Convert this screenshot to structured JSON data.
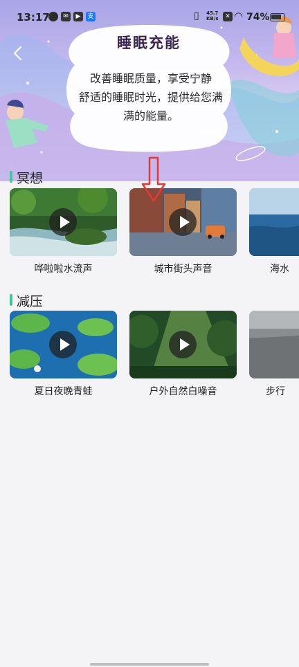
{
  "status_bar": {
    "time": "13:17",
    "net_speed_value": "45.7",
    "net_speed_unit": "KB/s",
    "battery": "74%"
  },
  "header": {
    "title": "睡眠充能",
    "description_lines": [
      "改善睡眠质量，享受宁静",
      "舒适的睡眠时光，提供给您满",
      "满的能量。"
    ]
  },
  "sections": [
    {
      "title": "冥想",
      "items": [
        {
          "label": "哗啦啦水流声"
        },
        {
          "label": "城市街头声音"
        },
        {
          "label": "海水"
        }
      ]
    },
    {
      "title": "减压",
      "items": [
        {
          "label": "夏日夜晚青蛙"
        },
        {
          "label": "户外自然白噪音"
        },
        {
          "label": "步行"
        }
      ]
    }
  ],
  "colors": {
    "accent": "#3ec79a",
    "annotation": "#e53935",
    "title": "#3a2452"
  }
}
